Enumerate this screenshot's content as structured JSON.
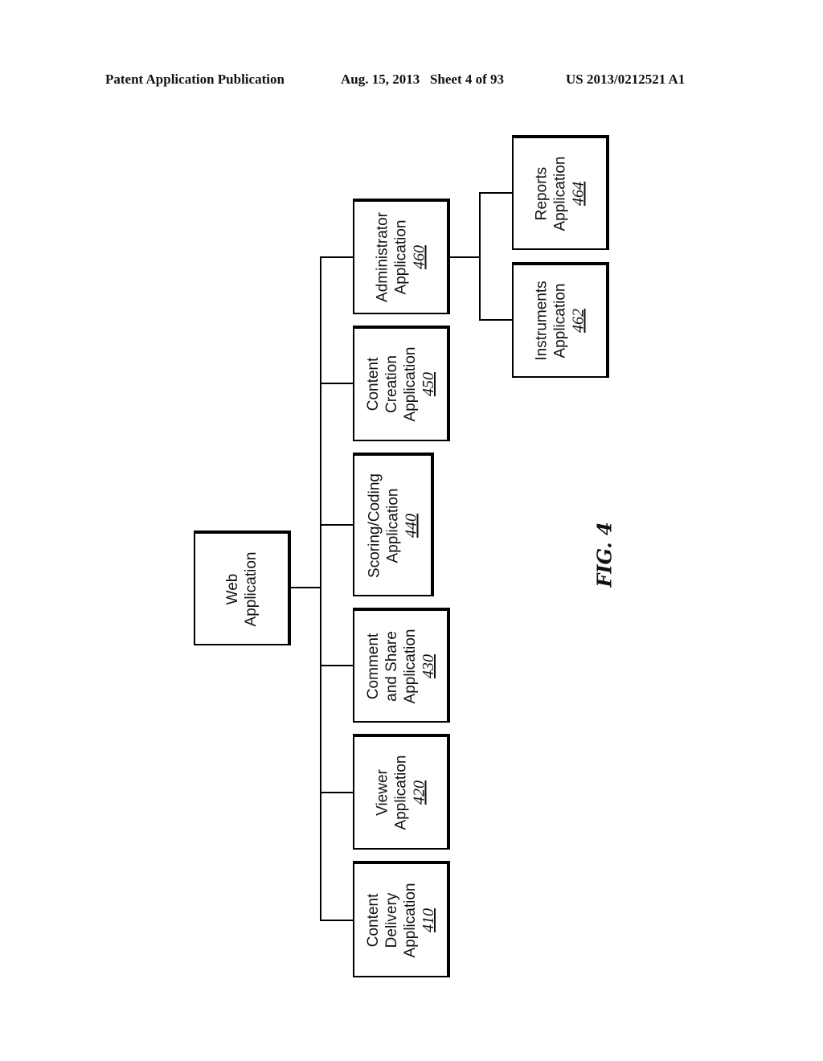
{
  "header": {
    "publication": "Patent Application Publication",
    "date_sheet": "Aug. 15, 2013   Sheet 4 of 93",
    "number": "US 2013/0212521 A1"
  },
  "figure_label": "FIG. 4",
  "nodes": {
    "web": {
      "lines": [
        "Web",
        "Application"
      ],
      "ref": ""
    },
    "n410": {
      "lines": [
        "Content",
        "Delivery",
        "Application"
      ],
      "ref": "410"
    },
    "n420": {
      "lines": [
        "Viewer",
        "Application"
      ],
      "ref": "420"
    },
    "n430": {
      "lines": [
        "Comment",
        "and Share",
        "Application"
      ],
      "ref": "430"
    },
    "n440": {
      "lines": [
        "Scoring/Coding",
        "Application"
      ],
      "ref": "440"
    },
    "n450": {
      "lines": [
        "Content",
        "Creation",
        "Application"
      ],
      "ref": "450"
    },
    "n460": {
      "lines": [
        "Administrator",
        "Application"
      ],
      "ref": "460"
    },
    "n462": {
      "lines": [
        "Instruments",
        "Application"
      ],
      "ref": "462"
    },
    "n464": {
      "lines": [
        "Reports",
        "Application"
      ],
      "ref": "464"
    }
  },
  "edges": [
    [
      "web",
      "n410"
    ],
    [
      "web",
      "n420"
    ],
    [
      "web",
      "n430"
    ],
    [
      "web",
      "n440"
    ],
    [
      "web",
      "n450"
    ],
    [
      "web",
      "n460"
    ],
    [
      "n460",
      "n462"
    ],
    [
      "n460",
      "n464"
    ]
  ]
}
